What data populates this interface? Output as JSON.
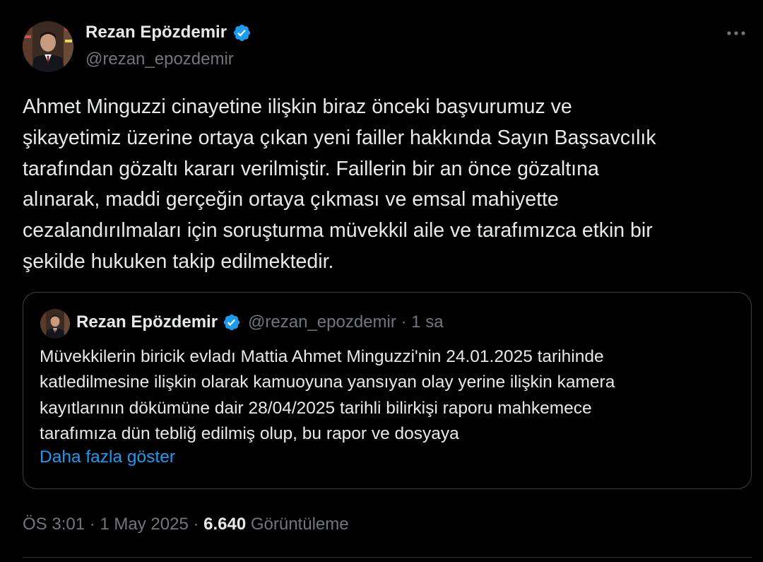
{
  "author": {
    "name": "Rezan Epözdemir",
    "handle": "@rezan_epozdemir",
    "verified_icon": "verified-badge-icon",
    "avatar_icon": "profile-photo"
  },
  "more_icon": "more-horizontal-icon",
  "tweet": {
    "text": "Ahmet Minguzzi cinayetine ilişkin biraz önceki başvurumuz ve\nşikayetimiz üzerine ortaya çıkan yeni failler hakkında Sayın Başsavcılık\ntarafından gözaltı kararı verilmiştir. Faillerin bir an önce gözaltına\nalınarak, maddi gerçeğin ortaya çıkması ve emsal mahiyette\ncezalandırılmaları için soruşturma müvekkil aile ve tarafımızca etkin bir\nşekilde hukuken takip edilmektedir."
  },
  "quote": {
    "name": "Rezan Epözdemir",
    "handle_time": "@rezan_epozdemir · 1 sa",
    "text": "Müvekkilerin biricik evladı Mattia Ahmet Minguzzi'nin 24.01.2025 tarihinde\nkatledilmesine ilişkin olarak kamuoyuna yansıyan olay yerine ilişkin kamera\nkayıtlarının dökümüne dair 28/04/2025 tarihli bilirkişi raporu mahkemece\ntarafımıza dün tebliğ edilmiş olup, bu rapor ve dosyaya",
    "show_more": "Daha fazla göster"
  },
  "meta": {
    "time": "ÖS 3:01 · 1 May 2025 · ",
    "views_count": "6.640",
    "views_label": " Görüntüleme"
  },
  "colors": {
    "background": "#000000",
    "text": "#e7e9ea",
    "secondary": "#71767b",
    "accent": "#1d9bf0",
    "border": "#3e4144"
  }
}
